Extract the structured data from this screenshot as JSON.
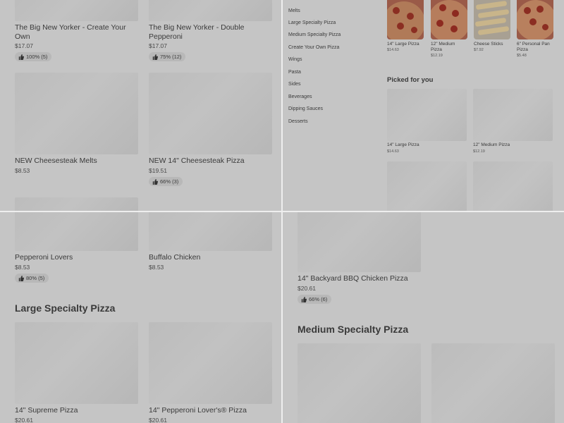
{
  "top_left": {
    "items": [
      {
        "title": "The Big New Yorker - Create Your Own",
        "price": "$17.07",
        "rating": "100% (5)"
      },
      {
        "title": "The Big New Yorker - Double Pepperoni",
        "price": "$17.07",
        "rating": "75% (12)"
      },
      {
        "title": "NEW Cheesesteak Melts",
        "price": "$8.53"
      },
      {
        "title": "NEW 14\" Cheesesteak Pizza",
        "price": "$19.51",
        "rating": "66% (3)"
      }
    ]
  },
  "top_right": {
    "nav": [
      "Melts",
      "Large Specialty Pizza",
      "Medium Specialty Pizza",
      "Create Your Own Pizza",
      "Wings",
      "Pasta",
      "Sides",
      "Beverages",
      "Dipping Sauces",
      "Desserts"
    ],
    "featured": [
      {
        "title": "14\" Large Pizza",
        "price": "$14.63"
      },
      {
        "title": "12\" Medium Pizza",
        "price": "$12.19"
      },
      {
        "title": "Cheese Sticks",
        "price": "$7.92"
      },
      {
        "title": "6\" Personal Pan Pizza",
        "price": "$5.48"
      }
    ],
    "picked_heading": "Picked for you",
    "picked": [
      {
        "title": "14\" Large Pizza",
        "price": "$14.63"
      },
      {
        "title": "12\" Medium Pizza",
        "price": "$12.19"
      }
    ]
  },
  "bottom_left": {
    "items": [
      {
        "title": "Pepperoni Lovers",
        "price": "$8.53",
        "rating": "80% (5)"
      },
      {
        "title": "Buffalo Chicken",
        "price": "$8.53"
      }
    ],
    "section_heading": "Large Specialty Pizza",
    "section_items": [
      {
        "title": "14\" Supreme Pizza",
        "price": "$20.61"
      },
      {
        "title": "14\" Pepperoni Lover's® Pizza",
        "price": "$20.61"
      }
    ]
  },
  "bottom_right": {
    "item": {
      "title": "14\" Backyard BBQ Chicken Pizza",
      "price": "$20.61",
      "rating": "66% (6)"
    },
    "section_heading": "Medium Specialty Pizza"
  }
}
